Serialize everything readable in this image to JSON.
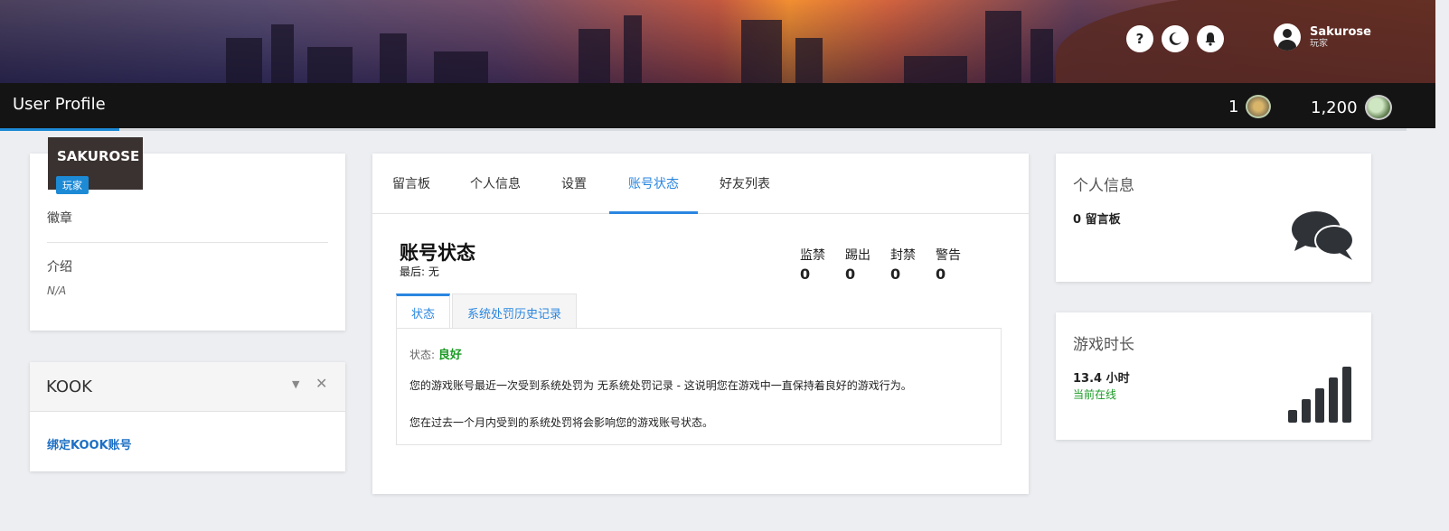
{
  "header": {
    "help_glyph": "?",
    "user_name": "Sakurose",
    "user_role": "玩家"
  },
  "topbar": {
    "title": "User Profile",
    "rank_value": "1",
    "coins_value": "1,200"
  },
  "profile": {
    "name": "SAKUROSE",
    "role": "玩家",
    "badges_label": "徽章",
    "intro_label": "介绍",
    "intro_value": "N/A"
  },
  "kook": {
    "title": "KOOK",
    "caret": "▼",
    "close": "✕",
    "link": "绑定KOOK账号"
  },
  "tabs": [
    "留言板",
    "个人信息",
    "设置",
    "账号状态",
    "好友列表"
  ],
  "account": {
    "title": "账号状态",
    "last": "最后: 无",
    "stats": [
      {
        "label": "监禁",
        "value": "0"
      },
      {
        "label": "踢出",
        "value": "0"
      },
      {
        "label": "封禁",
        "value": "0"
      },
      {
        "label": "警告",
        "value": "0"
      }
    ],
    "subtabs": [
      "状态",
      "系统处罚历史记录"
    ],
    "status_label": "状态:",
    "status_value": "良好",
    "paragraph1": "您的游戏账号最近一次受到系统处罚为 无系统处罚记录 - 这说明您在游戏中一直保持着良好的游戏行为。",
    "paragraph2": "您在过去一个月内受到的系统处罚将会影响您的游戏账号状态。"
  },
  "personal_info": {
    "title": "个人信息",
    "value": "0 留言板"
  },
  "playtime": {
    "title": "游戏时长",
    "value": "13.4 小时",
    "status": "当前在线"
  },
  "colors": {
    "accent": "#2a86e0",
    "good": "#1a9a24",
    "topbar": "#141414"
  }
}
